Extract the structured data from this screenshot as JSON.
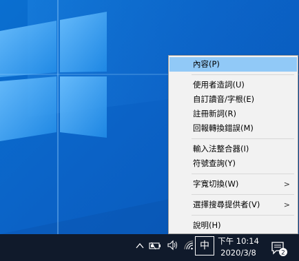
{
  "context_menu": {
    "items": [
      {
        "label": "內容(P)",
        "highlighted": true
      },
      {
        "label": "使用者造詞(U)"
      },
      {
        "label": "自訂讀音/字根(E)"
      },
      {
        "label": "註冊新詞(R)"
      },
      {
        "label": "回報轉換錯誤(M)"
      },
      {
        "label": "輸入法整合器(I)"
      },
      {
        "label": "符號查詢(Y)"
      },
      {
        "label": "字寬切換(W)",
        "submenu": true
      },
      {
        "label": "選擇搜尋提供者(V)",
        "submenu": true
      },
      {
        "label": "說明(H)"
      }
    ],
    "submenu_arrow": ">"
  },
  "taskbar": {
    "ime_indicator": "中",
    "clock_time": "下午 10:14",
    "clock_date": "2020/3/8",
    "notification_count": "2"
  },
  "colors": {
    "desktop_blue": "#0b62c6",
    "menu_bg": "#f2f2f2",
    "menu_highlight": "#91c9f7",
    "taskbar_bg": "#101a2b"
  }
}
